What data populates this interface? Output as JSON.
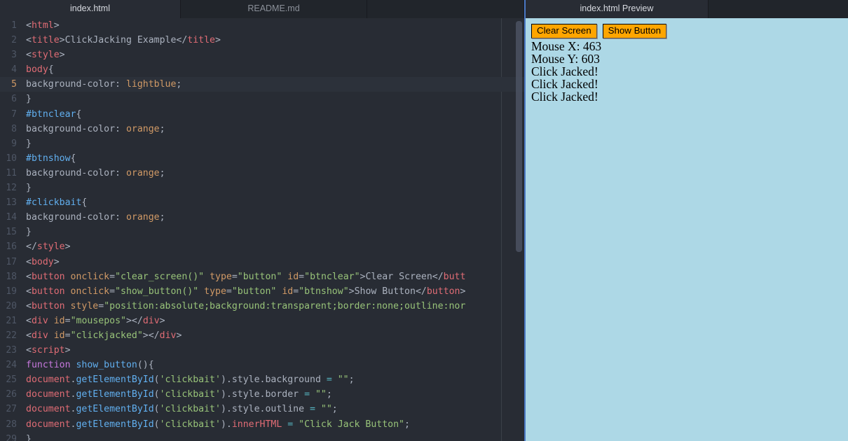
{
  "editor": {
    "tabs": [
      {
        "label": "index.html",
        "active": true
      },
      {
        "label": "README.md",
        "active": false
      },
      {
        "label": "",
        "active": false
      }
    ],
    "active_line": 5,
    "lines": [
      {
        "n": "1",
        "tokens": [
          {
            "t": "punc",
            "v": "<"
          },
          {
            "t": "tag",
            "v": "html"
          },
          {
            "t": "punc",
            "v": ">"
          }
        ]
      },
      {
        "n": "2",
        "tokens": [
          {
            "t": "plain",
            "v": "  "
          },
          {
            "t": "punc",
            "v": "<"
          },
          {
            "t": "tag",
            "v": "title"
          },
          {
            "t": "punc",
            "v": ">"
          },
          {
            "t": "text",
            "v": "ClickJacking Example"
          },
          {
            "t": "punc",
            "v": "</"
          },
          {
            "t": "tag",
            "v": "title"
          },
          {
            "t": "punc",
            "v": ">"
          }
        ]
      },
      {
        "n": "3",
        "tokens": [
          {
            "t": "plain",
            "v": "  "
          },
          {
            "t": "punc",
            "v": "<"
          },
          {
            "t": "tag",
            "v": "style"
          },
          {
            "t": "punc",
            "v": ">"
          }
        ]
      },
      {
        "n": "4",
        "tokens": [
          {
            "t": "plain",
            "v": "  "
          },
          {
            "t": "tag",
            "v": "body"
          },
          {
            "t": "punc",
            "v": "{"
          }
        ]
      },
      {
        "n": "5",
        "tokens": [
          {
            "t": "plain",
            "v": "    "
          },
          {
            "t": "prop",
            "v": "background-color"
          },
          {
            "t": "punc",
            "v": ": "
          },
          {
            "t": "val",
            "v": "lightblue"
          },
          {
            "t": "punc",
            "v": ";"
          }
        ]
      },
      {
        "n": "6",
        "tokens": [
          {
            "t": "plain",
            "v": "  "
          },
          {
            "t": "punc",
            "v": "}"
          }
        ]
      },
      {
        "n": "7",
        "tokens": [
          {
            "t": "plain",
            "v": "  "
          },
          {
            "t": "sel",
            "v": "#btnclear"
          },
          {
            "t": "punc",
            "v": "{"
          }
        ]
      },
      {
        "n": "8",
        "tokens": [
          {
            "t": "plain",
            "v": "    "
          },
          {
            "t": "prop",
            "v": "background-color"
          },
          {
            "t": "punc",
            "v": ": "
          },
          {
            "t": "val",
            "v": "orange"
          },
          {
            "t": "punc",
            "v": ";"
          }
        ]
      },
      {
        "n": "9",
        "tokens": [
          {
            "t": "plain",
            "v": "  "
          },
          {
            "t": "punc",
            "v": "}"
          }
        ]
      },
      {
        "n": "10",
        "tokens": [
          {
            "t": "plain",
            "v": "  "
          },
          {
            "t": "sel",
            "v": "#btnshow"
          },
          {
            "t": "punc",
            "v": "{"
          }
        ]
      },
      {
        "n": "11",
        "tokens": [
          {
            "t": "plain",
            "v": "    "
          },
          {
            "t": "prop",
            "v": "background-color"
          },
          {
            "t": "punc",
            "v": ": "
          },
          {
            "t": "val",
            "v": "orange"
          },
          {
            "t": "punc",
            "v": ";"
          }
        ]
      },
      {
        "n": "12",
        "tokens": [
          {
            "t": "plain",
            "v": "  "
          },
          {
            "t": "punc",
            "v": "}"
          }
        ]
      },
      {
        "n": "13",
        "tokens": [
          {
            "t": "plain",
            "v": "  "
          },
          {
            "t": "sel",
            "v": "#clickbait"
          },
          {
            "t": "punc",
            "v": "{"
          }
        ]
      },
      {
        "n": "14",
        "tokens": [
          {
            "t": "plain",
            "v": "    "
          },
          {
            "t": "prop",
            "v": "background-color"
          },
          {
            "t": "punc",
            "v": ": "
          },
          {
            "t": "val",
            "v": "orange"
          },
          {
            "t": "punc",
            "v": ";"
          }
        ]
      },
      {
        "n": "15",
        "tokens": [
          {
            "t": "plain",
            "v": "  "
          },
          {
            "t": "punc",
            "v": "}"
          }
        ]
      },
      {
        "n": "16",
        "tokens": [
          {
            "t": "plain",
            "v": "  "
          },
          {
            "t": "punc",
            "v": "</"
          },
          {
            "t": "tag",
            "v": "style"
          },
          {
            "t": "punc",
            "v": ">"
          }
        ]
      },
      {
        "n": "17",
        "tokens": [
          {
            "t": "plain",
            "v": "  "
          },
          {
            "t": "punc",
            "v": "<"
          },
          {
            "t": "tag",
            "v": "body"
          },
          {
            "t": "punc",
            "v": ">"
          }
        ]
      },
      {
        "n": "18",
        "tokens": [
          {
            "t": "plain",
            "v": "    "
          },
          {
            "t": "punc",
            "v": "<"
          },
          {
            "t": "tag",
            "v": "button"
          },
          {
            "t": "plain",
            "v": " "
          },
          {
            "t": "attr",
            "v": "onclick"
          },
          {
            "t": "punc",
            "v": "="
          },
          {
            "t": "str",
            "v": "\"clear_screen()\""
          },
          {
            "t": "plain",
            "v": " "
          },
          {
            "t": "attr",
            "v": "type"
          },
          {
            "t": "punc",
            "v": "="
          },
          {
            "t": "str",
            "v": "\"button\""
          },
          {
            "t": "plain",
            "v": " "
          },
          {
            "t": "attr",
            "v": "id"
          },
          {
            "t": "punc",
            "v": "="
          },
          {
            "t": "str",
            "v": "\"btnclear\""
          },
          {
            "t": "punc",
            "v": ">"
          },
          {
            "t": "text",
            "v": "Clear Screen"
          },
          {
            "t": "punc",
            "v": "</"
          },
          {
            "t": "tag",
            "v": "butt"
          }
        ]
      },
      {
        "n": "19",
        "tokens": [
          {
            "t": "plain",
            "v": "    "
          },
          {
            "t": "punc",
            "v": "<"
          },
          {
            "t": "tag",
            "v": "button"
          },
          {
            "t": "plain",
            "v": " "
          },
          {
            "t": "attr",
            "v": "onclick"
          },
          {
            "t": "punc",
            "v": "="
          },
          {
            "t": "str",
            "v": "\"show_button()\""
          },
          {
            "t": "plain",
            "v": " "
          },
          {
            "t": "attr",
            "v": "type"
          },
          {
            "t": "punc",
            "v": "="
          },
          {
            "t": "str",
            "v": "\"button\""
          },
          {
            "t": "plain",
            "v": " "
          },
          {
            "t": "attr",
            "v": "id"
          },
          {
            "t": "punc",
            "v": "="
          },
          {
            "t": "str",
            "v": "\"btnshow\""
          },
          {
            "t": "punc",
            "v": ">"
          },
          {
            "t": "text",
            "v": "Show Button"
          },
          {
            "t": "punc",
            "v": "</"
          },
          {
            "t": "tag",
            "v": "button"
          },
          {
            "t": "punc",
            "v": ">"
          }
        ]
      },
      {
        "n": "20",
        "tokens": [
          {
            "t": "plain",
            "v": "    "
          },
          {
            "t": "punc",
            "v": "<"
          },
          {
            "t": "tag",
            "v": "button"
          },
          {
            "t": "plain",
            "v": " "
          },
          {
            "t": "attr",
            "v": "style"
          },
          {
            "t": "punc",
            "v": "="
          },
          {
            "t": "str",
            "v": "\"position:absolute;background:transparent;border:none;outline:nor"
          }
        ]
      },
      {
        "n": "21",
        "tokens": [
          {
            "t": "plain",
            "v": "    "
          },
          {
            "t": "punc",
            "v": "<"
          },
          {
            "t": "tag",
            "v": "div"
          },
          {
            "t": "plain",
            "v": " "
          },
          {
            "t": "attr",
            "v": "id"
          },
          {
            "t": "punc",
            "v": "="
          },
          {
            "t": "str",
            "v": "\"mousepos\""
          },
          {
            "t": "punc",
            "v": "></"
          },
          {
            "t": "tag",
            "v": "div"
          },
          {
            "t": "punc",
            "v": ">"
          }
        ]
      },
      {
        "n": "22",
        "tokens": [
          {
            "t": "plain",
            "v": "    "
          },
          {
            "t": "punc",
            "v": "<"
          },
          {
            "t": "tag",
            "v": "div"
          },
          {
            "t": "plain",
            "v": " "
          },
          {
            "t": "attr",
            "v": "id"
          },
          {
            "t": "punc",
            "v": "="
          },
          {
            "t": "str",
            "v": "\"clickjacked\""
          },
          {
            "t": "punc",
            "v": "></"
          },
          {
            "t": "tag",
            "v": "div"
          },
          {
            "t": "punc",
            "v": ">"
          }
        ]
      },
      {
        "n": "23",
        "tokens": [
          {
            "t": "plain",
            "v": "    "
          },
          {
            "t": "punc",
            "v": "<"
          },
          {
            "t": "tag",
            "v": "script"
          },
          {
            "t": "punc",
            "v": ">"
          }
        ]
      },
      {
        "n": "24",
        "tokens": [
          {
            "t": "plain",
            "v": "      "
          },
          {
            "t": "kw",
            "v": "function"
          },
          {
            "t": "plain",
            "v": " "
          },
          {
            "t": "fn",
            "v": "show_button"
          },
          {
            "t": "punc",
            "v": "(){"
          }
        ]
      },
      {
        "n": "25",
        "tokens": [
          {
            "t": "plain",
            "v": "        "
          },
          {
            "t": "obj",
            "v": "document"
          },
          {
            "t": "punc",
            "v": "."
          },
          {
            "t": "meth",
            "v": "getElementById"
          },
          {
            "t": "punc",
            "v": "("
          },
          {
            "t": "str",
            "v": "'clickbait'"
          },
          {
            "t": "punc",
            "v": ")."
          },
          {
            "t": "plain",
            "v": "style"
          },
          {
            "t": "punc",
            "v": "."
          },
          {
            "t": "plain",
            "v": "background"
          },
          {
            "t": "op",
            "v": " = "
          },
          {
            "t": "str",
            "v": "\"\""
          },
          {
            "t": "punc",
            "v": ";"
          }
        ]
      },
      {
        "n": "26",
        "tokens": [
          {
            "t": "plain",
            "v": "        "
          },
          {
            "t": "obj",
            "v": "document"
          },
          {
            "t": "punc",
            "v": "."
          },
          {
            "t": "meth",
            "v": "getElementById"
          },
          {
            "t": "punc",
            "v": "("
          },
          {
            "t": "str",
            "v": "'clickbait'"
          },
          {
            "t": "punc",
            "v": ")."
          },
          {
            "t": "plain",
            "v": "style"
          },
          {
            "t": "punc",
            "v": "."
          },
          {
            "t": "plain",
            "v": "border"
          },
          {
            "t": "op",
            "v": " = "
          },
          {
            "t": "str",
            "v": "\"\""
          },
          {
            "t": "punc",
            "v": ";"
          }
        ]
      },
      {
        "n": "27",
        "tokens": [
          {
            "t": "plain",
            "v": "        "
          },
          {
            "t": "obj",
            "v": "document"
          },
          {
            "t": "punc",
            "v": "."
          },
          {
            "t": "meth",
            "v": "getElementById"
          },
          {
            "t": "punc",
            "v": "("
          },
          {
            "t": "str",
            "v": "'clickbait'"
          },
          {
            "t": "punc",
            "v": ")."
          },
          {
            "t": "plain",
            "v": "style"
          },
          {
            "t": "punc",
            "v": "."
          },
          {
            "t": "plain",
            "v": "outline"
          },
          {
            "t": "op",
            "v": " = "
          },
          {
            "t": "str",
            "v": "\"\""
          },
          {
            "t": "punc",
            "v": ";"
          }
        ]
      },
      {
        "n": "28",
        "tokens": [
          {
            "t": "plain",
            "v": "        "
          },
          {
            "t": "obj",
            "v": "document"
          },
          {
            "t": "punc",
            "v": "."
          },
          {
            "t": "meth",
            "v": "getElementById"
          },
          {
            "t": "punc",
            "v": "("
          },
          {
            "t": "str",
            "v": "'clickbait'"
          },
          {
            "t": "punc",
            "v": ")."
          },
          {
            "t": "obj",
            "v": "innerHTML"
          },
          {
            "t": "op",
            "v": " = "
          },
          {
            "t": "str",
            "v": "\"Click Jack Button\""
          },
          {
            "t": "punc",
            "v": ";"
          }
        ]
      },
      {
        "n": "29",
        "tokens": [
          {
            "t": "plain",
            "v": "      "
          },
          {
            "t": "punc",
            "v": "}"
          }
        ]
      }
    ]
  },
  "preview": {
    "tabs": [
      {
        "label": "index.html Preview",
        "active": true
      },
      {
        "label": "",
        "active": false
      }
    ],
    "buttons": [
      {
        "label": "Clear Screen",
        "id": "btnclear"
      },
      {
        "label": "Show Button",
        "id": "btnshow"
      }
    ],
    "output_lines": [
      "Mouse X: 463",
      "Mouse Y: 603",
      "Click Jacked!",
      "Click Jacked!",
      "Click Jacked!"
    ]
  },
  "colors": {
    "editor_bg": "#282c34",
    "tabbar_bg": "#21252b",
    "active_line_bg": "#2c313a",
    "preview_bg": "#add8e6",
    "button_bg": "#ffa500",
    "accent_divider": "#4a78c4"
  }
}
